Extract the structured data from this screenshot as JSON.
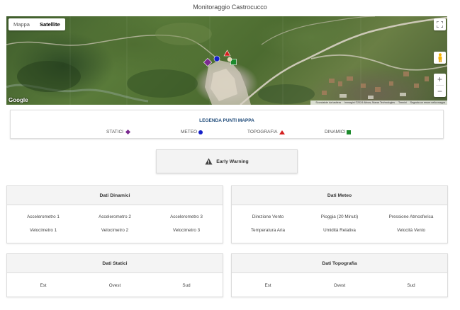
{
  "page": {
    "title": "Monitoraggio Castrocucco"
  },
  "map": {
    "map_type_options": [
      "Mappa",
      "Satellite"
    ],
    "selected_map_type": "Satellite",
    "fullscreen_icon": "fullscreen-icon",
    "pegman_icon": "pegman-icon",
    "zoom_in_label": "+",
    "zoom_out_label": "−",
    "logo": "Google",
    "attribution": {
      "shortcuts": "Scorciatoie da tastiera",
      "imagery": "Immagini ©2024 Airbus, Maxar Technologies",
      "terms": "Termini",
      "report": "Segnala un errore nella mappa"
    },
    "markers": [
      {
        "type": "statici",
        "color": "#7b2a8f",
        "shape": "diamond"
      },
      {
        "type": "meteo",
        "color": "#1520c8",
        "shape": "circle"
      },
      {
        "type": "topografia",
        "color": "#d41f1f",
        "shape": "triangle"
      },
      {
        "type": "dinamici",
        "color": "#1c8a2c",
        "shape": "square"
      }
    ]
  },
  "legend": {
    "title": "LEGENDA PUNTI MAPPA",
    "items": [
      {
        "label": "STATICI",
        "symbol": "diamond",
        "color": "#7b2a8f"
      },
      {
        "label": "METEO",
        "symbol": "circle",
        "color": "#1520c8"
      },
      {
        "label": "TOPOGRAFIA",
        "symbol": "triangle",
        "color": "#d41f1f"
      },
      {
        "label": "DINAMICI",
        "symbol": "square",
        "color": "#1c8a2c"
      }
    ]
  },
  "early_warning": {
    "label": "Early Warning",
    "icon": "warning-icon"
  },
  "cards": {
    "dinamici": {
      "title": "Dati Dinamici",
      "rows": [
        [
          "Accelerometro 1",
          "Accelerometro 2",
          "Accelerometro 3"
        ],
        [
          "Velocimetro 1",
          "Velocimetro 2",
          "Velocimetro 3"
        ]
      ]
    },
    "meteo": {
      "title": "Dati Meteo",
      "rows": [
        [
          "Direzione Vento",
          "Pioggia (20 Minuti)",
          "Pressione Atmosferica"
        ],
        [
          "Temperatura Aria",
          "Umidità Relativa",
          "Velocità Vento"
        ]
      ]
    },
    "statici": {
      "title": "Dati Statici",
      "rows": [
        [
          "Est",
          "Ovest",
          "Sud"
        ]
      ]
    },
    "topografia": {
      "title": "Dati Topografia",
      "rows": [
        [
          "Est",
          "Ovest",
          "Sud"
        ]
      ]
    }
  }
}
